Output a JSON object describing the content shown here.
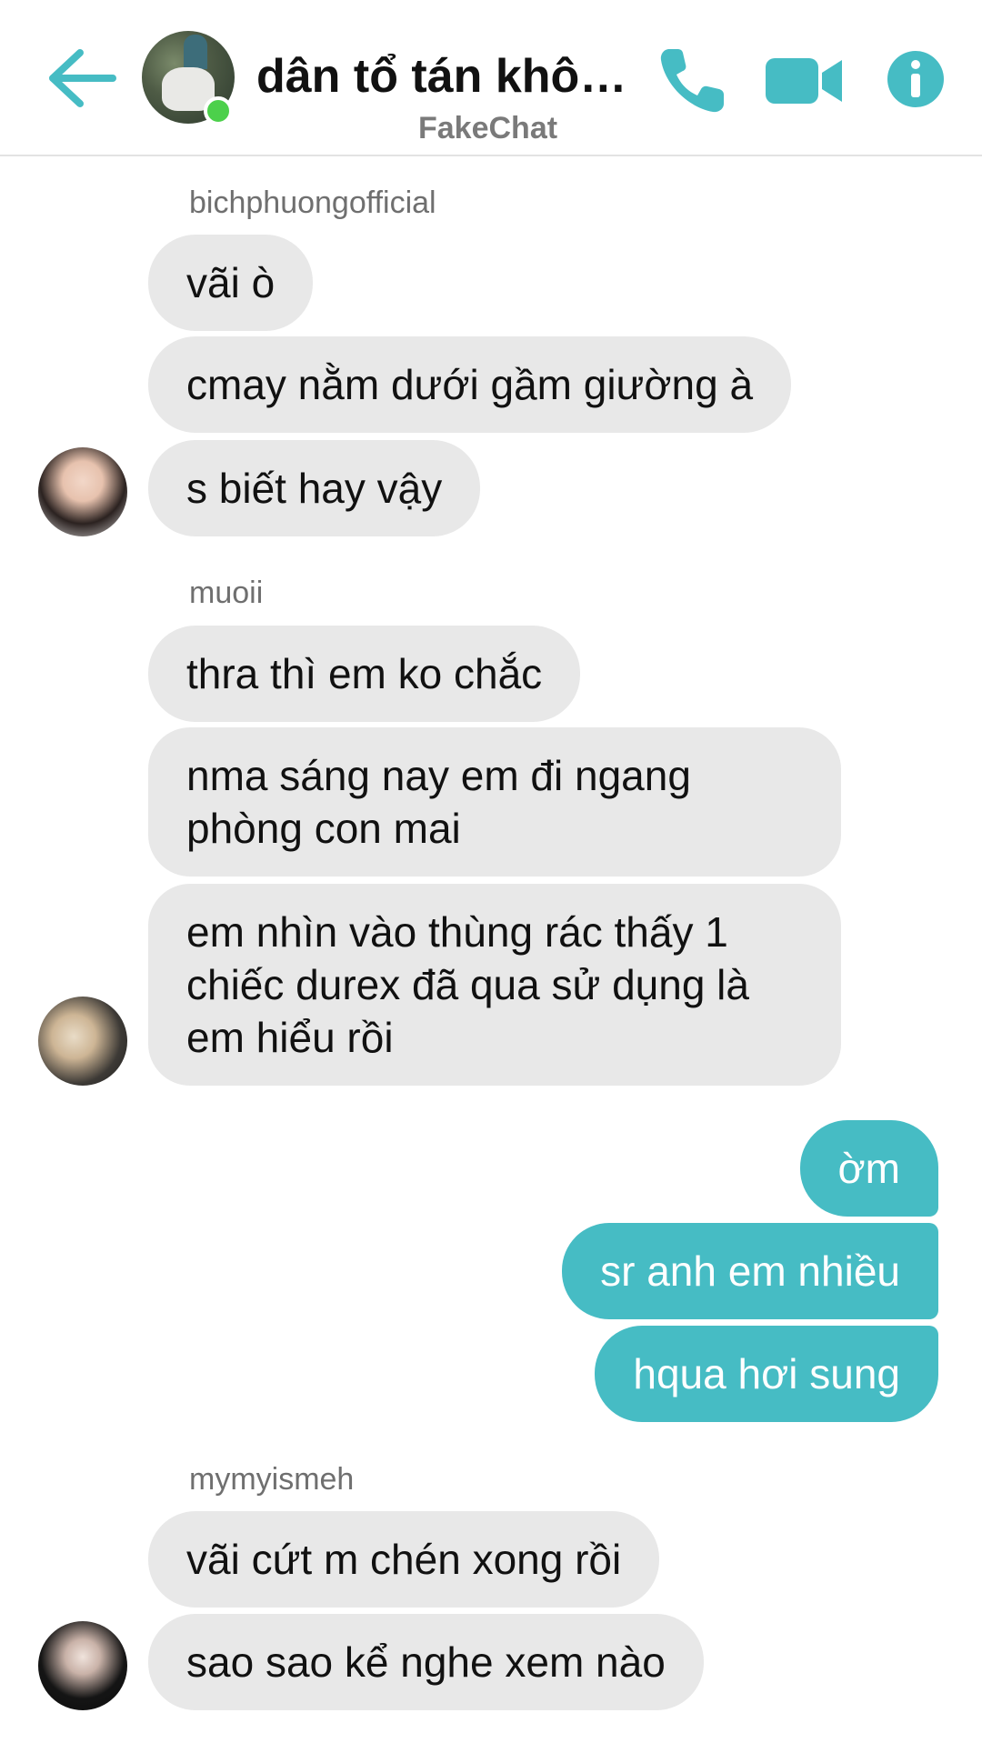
{
  "header": {
    "title": "dân tổ tán khôn...",
    "subtitle": "FakeChat",
    "accent_color": "#46bcc4",
    "status_color": "#4cd04b",
    "icons": [
      "back-arrow-icon",
      "phone-icon",
      "video-camera-icon",
      "info-icon"
    ]
  },
  "messages": {
    "group1": {
      "sender": "bichphuongofficial",
      "lines": [
        "vãi ò",
        "cmay nằm dưới gầm giường à",
        "s biết hay vậy"
      ]
    },
    "group2": {
      "sender": "muoii",
      "lines": [
        "thra thì em ko chắc",
        "nma sáng nay em đi ngang phòng con mai",
        "em nhìn vào thùng rác thấy 1 chiếc durex đã qua sử dụng là em hiểu rồi"
      ]
    },
    "mine": {
      "lines": [
        "ờm",
        "sr anh em nhiều",
        "hqua hơi sung"
      ]
    },
    "group3": {
      "sender": "mymyismeh",
      "lines": [
        "vãi cứt m chén xong rồi",
        "sao sao kể nghe xem nào"
      ]
    }
  }
}
